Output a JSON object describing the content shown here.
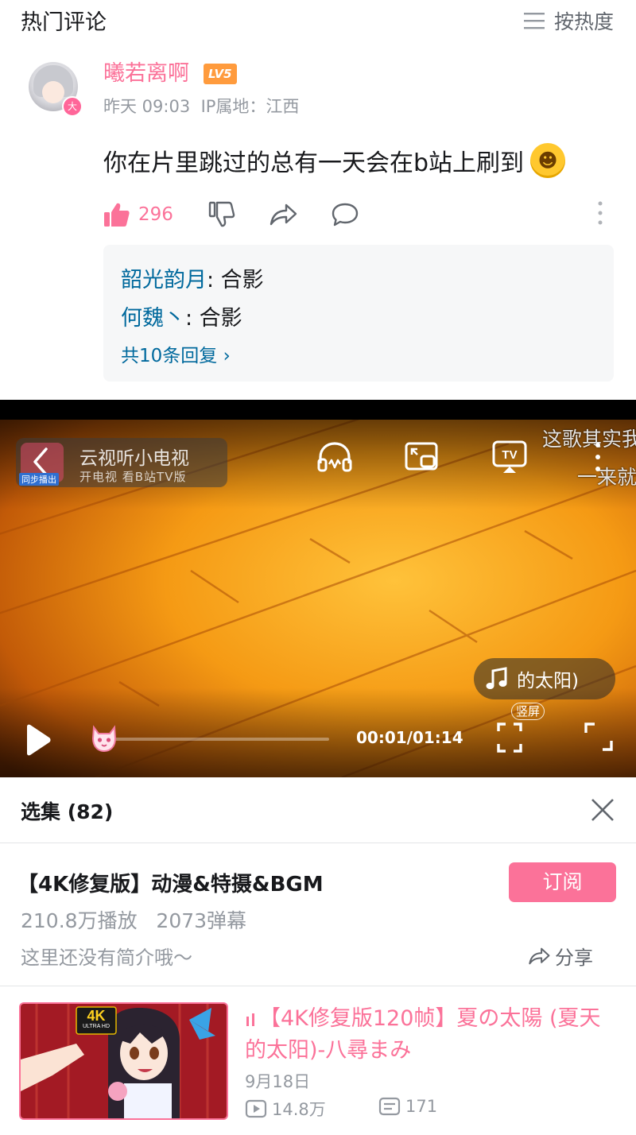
{
  "comments": {
    "section_title": "热门评论",
    "sort_label": "按热度",
    "item": {
      "username": "曦若离啊",
      "level": "LV5",
      "avatar_badge": "大",
      "timestamp": "昨天 09:03",
      "ip_location": "IP属地：江西",
      "text": "你在片里跳过的总有一天会在b站上刷到",
      "likes": "296",
      "replies": [
        {
          "user": "韶光韵月",
          "text": ": 合影"
        },
        {
          "user": "何魏丶",
          "text": ": 合影"
        }
      ],
      "more_replies": "共10条回复 ›"
    }
  },
  "player": {
    "cast_title": "云视听小电视",
    "cast_subtitle": "开电视 看B站TV版",
    "sync_label": "同步播出",
    "danmaku": [
      "这歌其实我",
      "一来就"
    ],
    "bgm_text": "的太阳)",
    "portrait_label": "竖屏",
    "time": "00:01/01:14",
    "progress": 0.014
  },
  "episodes": {
    "header": "选集 (82)",
    "series_title": "【4K修复版】动漫&特摄&BGM",
    "subscribe_label": "订阅",
    "plays": "210.8万播放",
    "danmaku_count": "2073弹幕",
    "intro": "这里还没有简介哦～",
    "share_label": "分享",
    "current": {
      "title": "【4K修复版120帧】夏の太陽 (夏天的太阳)-八尋まみ",
      "date": "9月18日",
      "plays": "14.8万",
      "danmaku": "171",
      "thumb_badge": "4K",
      "thumb_badge_sub": "ULTRA HD"
    }
  },
  "colors": {
    "accent": "#fb7299",
    "link": "#00699d",
    "muted": "#9499a0"
  }
}
